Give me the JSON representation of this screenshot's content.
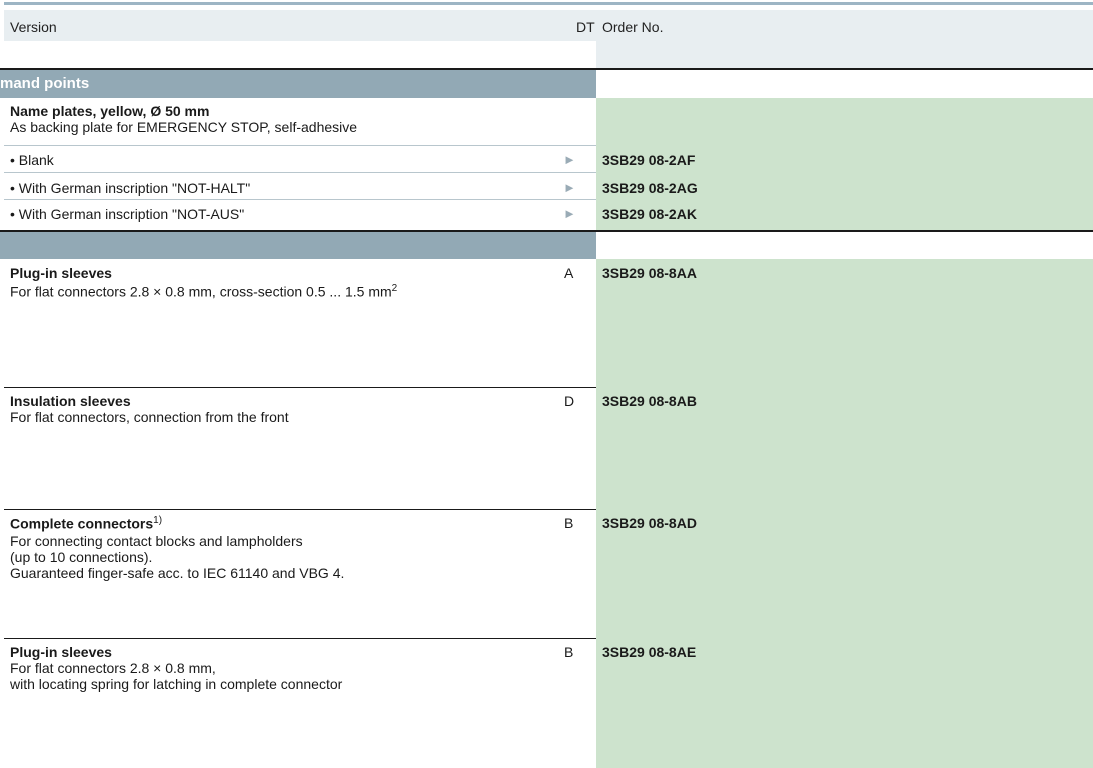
{
  "header": {
    "version": "Version",
    "dt": "DT",
    "order_no": "Order No."
  },
  "section1": {
    "title": "mand points",
    "item_title": "Name plates, yellow, Ø 50 mm",
    "item_desc": "As backing plate for EMERGENCY STOP, self-adhesive",
    "rows": [
      {
        "label": "• Blank",
        "marker": "►",
        "order": "3SB29 08-2AF"
      },
      {
        "label": "• With German inscription \"NOT-HALT\"",
        "marker": "►",
        "order": "3SB29 08-2AG"
      },
      {
        "label": "• With German inscription \"NOT-AUS\"",
        "marker": "►",
        "order": "3SB29 08-2AK"
      }
    ]
  },
  "items": [
    {
      "title": "Plug-in sleeves",
      "sup": "",
      "lines": [
        "For flat connectors 2.8 × 0.8 mm, cross-section 0.5 ... 1.5 mm"
      ],
      "line_sup": "2",
      "dt": "A",
      "order": "3SB29 08-8AA"
    },
    {
      "title": "Insulation sleeves",
      "sup": "",
      "lines": [
        "For flat connectors, connection from the front"
      ],
      "line_sup": "",
      "dt": "D",
      "order": "3SB29 08-8AB"
    },
    {
      "title": "Complete connectors",
      "sup": "1)",
      "lines": [
        "For connecting contact blocks and lampholders",
        "(up to 10 connections).",
        "Guaranteed finger-safe acc. to IEC 61140 and VBG 4."
      ],
      "line_sup": "",
      "dt": "B",
      "order": "3SB29 08-8AD"
    },
    {
      "title": "Plug-in sleeves",
      "sup": "",
      "lines": [
        "For flat connectors 2.8 × 0.8 mm,",
        "with locating spring for latching in complete connector"
      ],
      "line_sup": "",
      "dt": "B",
      "order": "3SB29 08-8AE"
    }
  ],
  "colors": {
    "section": "#92a9b5",
    "green": "#cde3cd",
    "header_bg": "#e8eef1",
    "arrow": "#9aabb6"
  }
}
